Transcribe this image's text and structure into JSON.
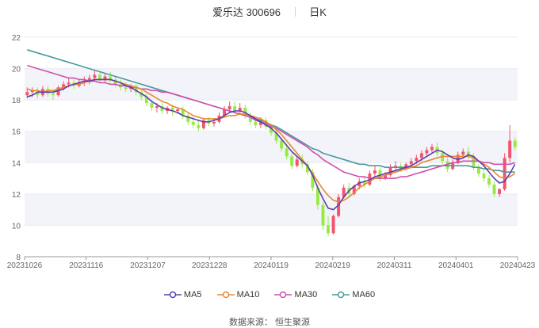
{
  "header": {
    "stock_name": "爱乐达 300696",
    "period": "日K"
  },
  "source": "数据来源： 恒生聚源",
  "colors": {
    "up": "#f4526f",
    "down": "#97ea46",
    "ma5": "#5b3fae",
    "ma10": "#e8892f",
    "ma30": "#d14fae",
    "ma60": "#4a9a9e",
    "grid": "#e8ebf2",
    "band": "#f2f4f9"
  },
  "chart_data": {
    "type": "candlestick",
    "title": "爱乐达 300696 日K",
    "ylim": [
      8,
      22
    ],
    "y_ticks": [
      "8",
      "10",
      "12",
      "14",
      "16",
      "18",
      "20",
      "22"
    ],
    "x_ticks": [
      "20231026",
      "20231116",
      "20231207",
      "20231228",
      "20240119",
      "20240219",
      "20240311",
      "20240401",
      "20240423"
    ],
    "legend": [
      "MA5",
      "MA10",
      "MA30",
      "MA60"
    ],
    "ohlc": [
      [
        18.3,
        18.8,
        18.5,
        18.1
      ],
      [
        18.5,
        18.8,
        18.6,
        18.2
      ],
      [
        18.6,
        18.8,
        18.3,
        18.1
      ],
      [
        18.3,
        18.9,
        18.7,
        18.2
      ],
      [
        18.7,
        18.9,
        18.4,
        18.2
      ],
      [
        18.4,
        18.6,
        18.3,
        18.0
      ],
      [
        18.3,
        18.9,
        18.8,
        18.2
      ],
      [
        18.8,
        19.2,
        19.0,
        18.6
      ],
      [
        19.0,
        19.4,
        19.1,
        18.8
      ],
      [
        19.1,
        19.3,
        18.9,
        18.7
      ],
      [
        18.9,
        19.3,
        19.1,
        18.8
      ],
      [
        19.1,
        19.5,
        19.2,
        18.9
      ],
      [
        19.2,
        19.6,
        19.4,
        19.0
      ],
      [
        19.4,
        19.9,
        19.6,
        19.2
      ],
      [
        19.6,
        19.8,
        19.3,
        19.1
      ],
      [
        19.3,
        19.7,
        19.5,
        19.1
      ],
      [
        19.5,
        19.8,
        19.3,
        19.0
      ],
      [
        19.3,
        19.5,
        19.0,
        18.8
      ],
      [
        19.0,
        19.3,
        18.8,
        18.6
      ],
      [
        18.8,
        19.1,
        18.7,
        18.5
      ],
      [
        18.7,
        19.0,
        18.9,
        18.5
      ],
      [
        18.9,
        19.0,
        18.5,
        18.3
      ],
      [
        18.5,
        18.7,
        18.2,
        18.0
      ],
      [
        18.2,
        18.4,
        17.8,
        17.6
      ],
      [
        17.8,
        18.0,
        17.5,
        17.3
      ],
      [
        17.5,
        17.8,
        17.6,
        17.2
      ],
      [
        17.6,
        17.8,
        17.3,
        17.1
      ],
      [
        17.3,
        17.6,
        17.5,
        17.1
      ],
      [
        17.5,
        17.7,
        17.3,
        17.0
      ],
      [
        17.3,
        17.5,
        17.4,
        17.1
      ],
      [
        17.4,
        17.6,
        17.0,
        16.8
      ],
      [
        17.0,
        17.2,
        16.6,
        16.4
      ],
      [
        16.6,
        16.9,
        16.4,
        16.2
      ],
      [
        16.4,
        16.7,
        16.2,
        16.0
      ],
      [
        16.2,
        16.8,
        16.7,
        16.1
      ],
      [
        16.7,
        16.9,
        16.5,
        16.3
      ],
      [
        16.5,
        16.8,
        16.6,
        16.3
      ],
      [
        16.6,
        17.2,
        17.0,
        16.5
      ],
      [
        17.0,
        17.6,
        17.4,
        16.9
      ],
      [
        17.4,
        17.9,
        17.6,
        17.2
      ],
      [
        17.6,
        17.9,
        17.3,
        17.1
      ],
      [
        17.3,
        17.8,
        17.5,
        17.1
      ],
      [
        17.5,
        17.7,
        17.0,
        16.8
      ],
      [
        17.0,
        17.2,
        16.6,
        16.4
      ],
      [
        16.6,
        16.8,
        16.4,
        16.2
      ],
      [
        16.4,
        16.9,
        16.7,
        16.2
      ],
      [
        16.7,
        16.9,
        16.3,
        16.1
      ],
      [
        16.3,
        16.5,
        15.9,
        15.7
      ],
      [
        15.9,
        16.1,
        15.4,
        15.2
      ],
      [
        15.4,
        15.6,
        14.9,
        14.7
      ],
      [
        14.9,
        15.2,
        14.4,
        14.2
      ],
      [
        14.4,
        14.6,
        13.8,
        13.6
      ],
      [
        13.8,
        14.4,
        14.2,
        13.7
      ],
      [
        14.2,
        14.5,
        13.9,
        13.7
      ],
      [
        13.9,
        14.1,
        13.4,
        13.2
      ],
      [
        13.4,
        13.6,
        12.4,
        12.2
      ],
      [
        12.4,
        12.6,
        11.3,
        11.0
      ],
      [
        11.3,
        11.5,
        10.0,
        9.7
      ],
      [
        10.0,
        10.6,
        9.5,
        9.3
      ],
      [
        9.5,
        10.7,
        10.6,
        9.4
      ],
      [
        10.6,
        12.0,
        11.8,
        10.5
      ],
      [
        11.8,
        12.6,
        12.4,
        11.7
      ],
      [
        12.4,
        12.7,
        12.0,
        11.8
      ],
      [
        12.0,
        12.6,
        12.5,
        11.9
      ],
      [
        12.5,
        13.0,
        12.8,
        12.3
      ],
      [
        12.8,
        13.1,
        12.6,
        12.4
      ],
      [
        12.6,
        13.5,
        13.3,
        12.5
      ],
      [
        13.3,
        13.8,
        13.5,
        13.1
      ],
      [
        13.5,
        13.7,
        13.0,
        12.8
      ],
      [
        13.0,
        13.4,
        13.2,
        12.9
      ],
      [
        13.2,
        13.9,
        13.7,
        13.1
      ],
      [
        13.7,
        14.1,
        13.8,
        13.5
      ],
      [
        13.8,
        14.0,
        13.6,
        13.4
      ],
      [
        13.6,
        14.0,
        13.9,
        13.5
      ],
      [
        13.9,
        14.3,
        14.1,
        13.7
      ],
      [
        14.1,
        14.5,
        14.3,
        13.9
      ],
      [
        14.3,
        14.8,
        14.6,
        14.1
      ],
      [
        14.6,
        15.0,
        14.8,
        14.4
      ],
      [
        14.8,
        15.2,
        15.0,
        14.6
      ],
      [
        15.0,
        15.3,
        14.6,
        14.4
      ],
      [
        14.6,
        14.8,
        14.1,
        13.9
      ],
      [
        14.1,
        14.3,
        13.6,
        13.4
      ],
      [
        13.6,
        14.2,
        14.0,
        13.5
      ],
      [
        14.0,
        14.7,
        14.5,
        13.9
      ],
      [
        14.5,
        14.9,
        14.7,
        14.3
      ],
      [
        14.7,
        15.0,
        14.4,
        14.2
      ],
      [
        14.4,
        14.6,
        13.7,
        13.5
      ],
      [
        13.7,
        13.9,
        13.3,
        13.1
      ],
      [
        13.3,
        13.5,
        13.0,
        12.8
      ],
      [
        13.0,
        13.2,
        12.6,
        12.4
      ],
      [
        12.6,
        12.8,
        12.0,
        11.8
      ],
      [
        12.0,
        12.4,
        12.3,
        11.8
      ],
      [
        12.3,
        14.6,
        14.3,
        12.2
      ],
      [
        14.3,
        16.4,
        15.4,
        14.0
      ],
      [
        15.4,
        15.6,
        15.0,
        14.8
      ]
    ],
    "ma5": [
      18.2,
      18.3,
      18.5,
      18.5,
      18.5,
      18.5,
      18.6,
      18.7,
      18.9,
      19.0,
      19.1,
      19.2,
      19.2,
      19.3,
      19.3,
      19.3,
      19.3,
      19.2,
      19.1,
      18.9,
      18.8,
      18.6,
      18.4,
      18.2,
      17.9,
      17.7,
      17.5,
      17.4,
      17.3,
      17.2,
      17.0,
      16.9,
      16.8,
      16.7,
      16.6,
      16.6,
      16.7,
      16.8,
      17.0,
      17.2,
      17.3,
      17.3,
      17.2,
      17.0,
      16.8,
      16.6,
      16.4,
      16.2,
      15.9,
      15.5,
      15.1,
      14.7,
      14.4,
      14.1,
      13.8,
      13.2,
      12.4,
      11.7,
      11.1,
      11.0,
      11.3,
      11.8,
      12.2,
      12.5,
      12.7,
      12.8,
      12.9,
      13.1,
      13.2,
      13.3,
      13.4,
      13.5,
      13.6,
      13.7,
      13.8,
      14.0,
      14.2,
      14.4,
      14.6,
      14.8,
      14.7,
      14.5,
      14.3,
      14.2,
      14.3,
      14.5,
      14.4,
      14.1,
      13.8,
      13.4,
      13.0,
      12.7,
      12.8,
      13.3,
      13.9
    ],
    "ma10": [
      18.7,
      18.6,
      18.6,
      18.5,
      18.6,
      18.6,
      18.7,
      18.8,
      18.9,
      19.0,
      19.0,
      19.1,
      19.2,
      19.3,
      19.3,
      19.3,
      19.3,
      19.2,
      19.1,
      19.0,
      18.9,
      18.8,
      18.7,
      18.5,
      18.3,
      18.1,
      17.9,
      17.8,
      17.6,
      17.5,
      17.4,
      17.2,
      17.0,
      16.9,
      16.8,
      16.8,
      16.8,
      16.8,
      16.9,
      17.0,
      17.0,
      17.1,
      17.1,
      17.0,
      16.9,
      16.8,
      16.6,
      16.4,
      16.1,
      15.8,
      15.4,
      15.0,
      14.6,
      14.2,
      13.8,
      13.3,
      12.8,
      12.3,
      11.9,
      11.6,
      11.5,
      11.6,
      11.8,
      12.1,
      12.4,
      12.6,
      12.8,
      13.0,
      13.1,
      13.2,
      13.3,
      13.4,
      13.5,
      13.6,
      13.7,
      13.8,
      14.0,
      14.1,
      14.2,
      14.3,
      14.4,
      14.4,
      14.4,
      14.4,
      14.4,
      14.4,
      14.3,
      14.1,
      13.9,
      13.7,
      13.4,
      13.1,
      13.0,
      13.1,
      13.3
    ],
    "ma30": [
      20.2,
      20.1,
      20.0,
      19.9,
      19.8,
      19.7,
      19.6,
      19.5,
      19.4,
      19.4,
      19.3,
      19.3,
      19.2,
      19.2,
      19.1,
      19.1,
      19.0,
      19.0,
      18.9,
      18.9,
      18.8,
      18.8,
      18.7,
      18.7,
      18.6,
      18.6,
      18.5,
      18.5,
      18.4,
      18.3,
      18.2,
      18.1,
      18.0,
      17.9,
      17.8,
      17.7,
      17.6,
      17.5,
      17.4,
      17.3,
      17.2,
      17.1,
      17.0,
      16.9,
      16.7,
      16.6,
      16.5,
      16.3,
      16.2,
      16.0,
      15.8,
      15.6,
      15.4,
      15.2,
      15.0,
      14.7,
      14.5,
      14.2,
      14.0,
      13.8,
      13.6,
      13.4,
      13.3,
      13.2,
      13.1,
      13.1,
      13.0,
      13.0,
      13.0,
      13.0,
      13.0,
      13.0,
      13.1,
      13.1,
      13.2,
      13.3,
      13.4,
      13.5,
      13.6,
      13.7,
      13.8,
      13.9,
      14.0,
      14.0,
      14.1,
      14.1,
      14.1,
      14.1,
      14.0,
      14.0,
      13.9,
      13.9,
      13.9,
      13.9,
      14.0
    ],
    "ma60": [
      21.2,
      21.1,
      21.0,
      20.9,
      20.8,
      20.7,
      20.6,
      20.5,
      20.4,
      20.3,
      20.2,
      20.1,
      20.0,
      19.9,
      19.8,
      19.7,
      19.6,
      19.5,
      19.4,
      19.3,
      19.2,
      19.1,
      19.0,
      18.9,
      18.8,
      18.7,
      18.6,
      18.5,
      18.4,
      18.3,
      18.2,
      18.1,
      18.0,
      17.9,
      17.8,
      17.7,
      17.6,
      17.5,
      17.4,
      17.3,
      17.2,
      17.1,
      17.0,
      16.9,
      16.8,
      16.7,
      16.6,
      16.4,
      16.3,
      16.1,
      15.9,
      15.7,
      15.5,
      15.3,
      15.1,
      14.9,
      14.8,
      14.6,
      14.5,
      14.4,
      14.3,
      14.2,
      14.1,
      14.0,
      13.9,
      13.9,
      13.8,
      13.8,
      13.8,
      13.7,
      13.7,
      13.7,
      13.7,
      13.7,
      13.7,
      13.7,
      13.7,
      13.7,
      13.8,
      13.8,
      13.8,
      13.8,
      13.8,
      13.8,
      13.8,
      13.8,
      13.7,
      13.7,
      13.6,
      13.6,
      13.5,
      13.5,
      13.4,
      13.4,
      13.4
    ]
  }
}
